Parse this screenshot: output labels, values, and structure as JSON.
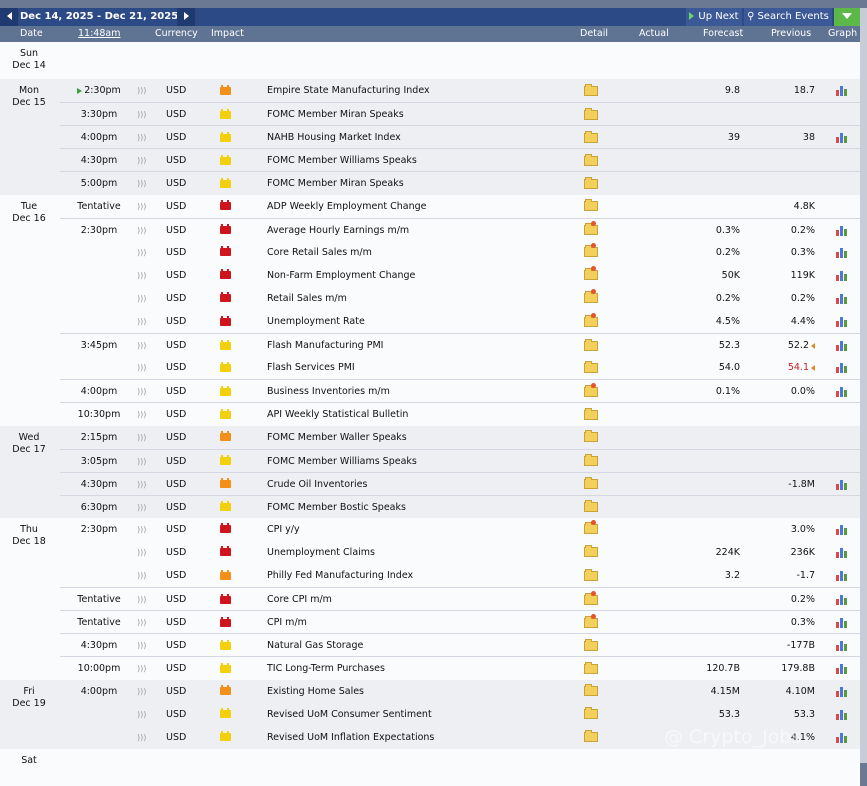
{
  "toolbar": {
    "date_range": "Dec 14, 2025 - Dec 21, 2025",
    "up_next": "Up Next",
    "search_events": "Search Events"
  },
  "header": {
    "date": "Date",
    "clock": "11:48am",
    "currency": "Currency",
    "impact": "Impact",
    "detail": "Detail",
    "actual": "Actual",
    "forecast": "Forecast",
    "previous": "Previous",
    "graph": "Graph"
  },
  "days": [
    {
      "dow": "Sun",
      "date": "Dec 14",
      "events": []
    },
    {
      "dow": "Mon",
      "date": "Dec 15",
      "events": [
        {
          "time": "2:30pm",
          "cur": "USD",
          "impact": "orange",
          "title": "Empire State Manufacturing Index",
          "detail": "folder",
          "forecast": "9.8",
          "previous": "18.7",
          "graph": true,
          "next": true
        },
        {
          "time": "3:30pm",
          "cur": "USD",
          "impact": "yellow",
          "title": "FOMC Member Miran Speaks",
          "detail": "folder",
          "forecast": "",
          "previous": "",
          "graph": false
        },
        {
          "time": "4:00pm",
          "cur": "USD",
          "impact": "yellow",
          "title": "NAHB Housing Market Index",
          "detail": "folder",
          "forecast": "39",
          "previous": "38",
          "graph": true
        },
        {
          "time": "4:30pm",
          "cur": "USD",
          "impact": "yellow",
          "title": "FOMC Member Williams Speaks",
          "detail": "folder",
          "forecast": "",
          "previous": "",
          "graph": false
        },
        {
          "time": "5:00pm",
          "cur": "USD",
          "impact": "yellow",
          "title": "FOMC Member Miran Speaks",
          "detail": "folder",
          "forecast": "",
          "previous": "",
          "graph": false
        }
      ]
    },
    {
      "dow": "Tue",
      "date": "Dec 16",
      "events": [
        {
          "time": "Tentative",
          "cur": "USD",
          "impact": "red",
          "title": "ADP Weekly Employment Change",
          "detail": "folder",
          "forecast": "",
          "previous": "4.8K",
          "graph": false
        },
        {
          "time": "2:30pm",
          "cur": "USD",
          "impact": "red",
          "title": "Average Hourly Earnings m/m",
          "detail": "star",
          "forecast": "0.3%",
          "previous": "0.2%",
          "graph": true
        },
        {
          "time": "",
          "cur": "USD",
          "impact": "red",
          "title": "Core Retail Sales m/m",
          "detail": "star",
          "forecast": "0.2%",
          "previous": "0.3%",
          "graph": true
        },
        {
          "time": "",
          "cur": "USD",
          "impact": "red",
          "title": "Non-Farm Employment Change",
          "detail": "star",
          "forecast": "50K",
          "previous": "119K",
          "graph": true
        },
        {
          "time": "",
          "cur": "USD",
          "impact": "red",
          "title": "Retail Sales m/m",
          "detail": "star",
          "forecast": "0.2%",
          "previous": "0.2%",
          "graph": true
        },
        {
          "time": "",
          "cur": "USD",
          "impact": "red",
          "title": "Unemployment Rate",
          "detail": "star",
          "forecast": "4.5%",
          "previous": "4.4%",
          "graph": true
        },
        {
          "time": "3:45pm",
          "cur": "USD",
          "impact": "yellow",
          "title": "Flash Manufacturing PMI",
          "detail": "folder",
          "forecast": "52.3",
          "previous": "52.2",
          "graph": true,
          "revised": true
        },
        {
          "time": "",
          "cur": "USD",
          "impact": "yellow",
          "title": "Flash Services PMI",
          "detail": "folder",
          "forecast": "54.0",
          "previous": "54.1",
          "graph": true,
          "revised": true,
          "prev_red": true
        },
        {
          "time": "4:00pm",
          "cur": "USD",
          "impact": "yellow",
          "title": "Business Inventories m/m",
          "detail": "star",
          "forecast": "0.1%",
          "previous": "0.0%",
          "graph": true
        },
        {
          "time": "10:30pm",
          "cur": "USD",
          "impact": "yellow",
          "title": "API Weekly Statistical Bulletin",
          "detail": "folder",
          "forecast": "",
          "previous": "",
          "graph": false
        }
      ]
    },
    {
      "dow": "Wed",
      "date": "Dec 17",
      "events": [
        {
          "time": "2:15pm",
          "cur": "USD",
          "impact": "orange",
          "title": "FOMC Member Waller Speaks",
          "detail": "folder",
          "forecast": "",
          "previous": "",
          "graph": false
        },
        {
          "time": "3:05pm",
          "cur": "USD",
          "impact": "yellow",
          "title": "FOMC Member Williams Speaks",
          "detail": "folder",
          "forecast": "",
          "previous": "",
          "graph": false
        },
        {
          "time": "4:30pm",
          "cur": "USD",
          "impact": "orange",
          "title": "Crude Oil Inventories",
          "detail": "folder",
          "forecast": "",
          "previous": "-1.8M",
          "graph": true
        },
        {
          "time": "6:30pm",
          "cur": "USD",
          "impact": "yellow",
          "title": "FOMC Member Bostic Speaks",
          "detail": "folder",
          "forecast": "",
          "previous": "",
          "graph": false
        }
      ]
    },
    {
      "dow": "Thu",
      "date": "Dec 18",
      "events": [
        {
          "time": "2:30pm",
          "cur": "USD",
          "impact": "red",
          "title": "CPI y/y",
          "detail": "star",
          "forecast": "",
          "previous": "3.0%",
          "graph": true
        },
        {
          "time": "",
          "cur": "USD",
          "impact": "red",
          "title": "Unemployment Claims",
          "detail": "folder",
          "forecast": "224K",
          "previous": "236K",
          "graph": true
        },
        {
          "time": "",
          "cur": "USD",
          "impact": "orange",
          "title": "Philly Fed Manufacturing Index",
          "detail": "folder",
          "forecast": "3.2",
          "previous": "-1.7",
          "graph": true
        },
        {
          "time": "Tentative",
          "cur": "USD",
          "impact": "red",
          "title": "Core CPI m/m",
          "detail": "star",
          "forecast": "",
          "previous": "0.2%",
          "graph": true
        },
        {
          "time": "Tentative",
          "cur": "USD",
          "impact": "red",
          "title": "CPI m/m",
          "detail": "star",
          "forecast": "",
          "previous": "0.3%",
          "graph": true
        },
        {
          "time": "4:30pm",
          "cur": "USD",
          "impact": "yellow",
          "title": "Natural Gas Storage",
          "detail": "folder",
          "forecast": "",
          "previous": "-177B",
          "graph": true
        },
        {
          "time": "10:00pm",
          "cur": "USD",
          "impact": "yellow",
          "title": "TIC Long-Term Purchases",
          "detail": "folder",
          "forecast": "120.7B",
          "previous": "179.8B",
          "graph": true
        }
      ]
    },
    {
      "dow": "Fri",
      "date": "Dec 19",
      "events": [
        {
          "time": "4:00pm",
          "cur": "USD",
          "impact": "orange",
          "title": "Existing Home Sales",
          "detail": "folder",
          "forecast": "4.15M",
          "previous": "4.10M",
          "graph": true
        },
        {
          "time": "",
          "cur": "USD",
          "impact": "yellow",
          "title": "Revised UoM Consumer Sentiment",
          "detail": "folder",
          "forecast": "53.3",
          "previous": "53.3",
          "graph": true
        },
        {
          "time": "",
          "cur": "USD",
          "impact": "yellow",
          "title": "Revised UoM Inflation Expectations",
          "detail": "folder",
          "forecast": "",
          "previous": "4.1%",
          "graph": true
        }
      ]
    },
    {
      "dow": "Sat",
      "date": "",
      "events": []
    }
  ],
  "watermark": "@ Crypto_Jobs"
}
